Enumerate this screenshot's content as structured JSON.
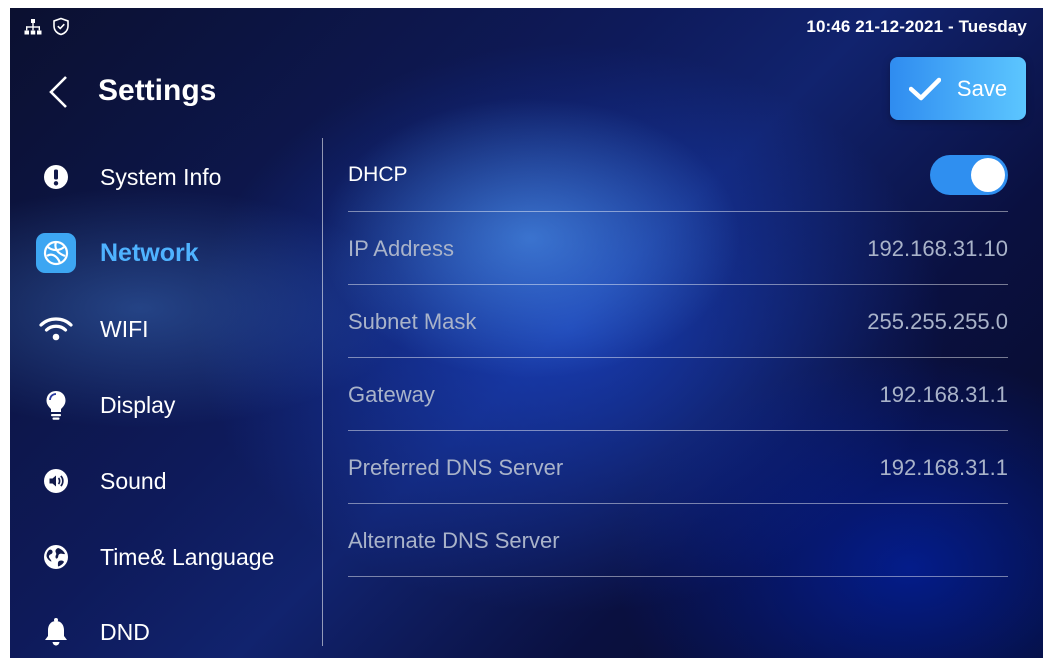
{
  "status_bar": {
    "icons": [
      "network-icon",
      "shield-icon"
    ],
    "datetime": "10:46  21-12-2021 - Tuesday"
  },
  "header": {
    "title": "Settings",
    "save_label": "Save"
  },
  "sidebar": {
    "items": [
      {
        "label": "System Info",
        "icon": "info-icon",
        "active": false
      },
      {
        "label": "Network",
        "icon": "network-globe-icon",
        "active": true
      },
      {
        "label": "WIFI",
        "icon": "wifi-icon",
        "active": false
      },
      {
        "label": "Display",
        "icon": "lightbulb-icon",
        "active": false
      },
      {
        "label": "Sound",
        "icon": "speaker-icon",
        "active": false
      },
      {
        "label": "Time& Language",
        "icon": "globe-icon",
        "active": false
      },
      {
        "label": "DND",
        "icon": "bell-icon",
        "active": false
      }
    ]
  },
  "network": {
    "dhcp": {
      "label": "DHCP",
      "enabled": true
    },
    "fields": [
      {
        "label": "IP Address",
        "value": "192.168.31.10"
      },
      {
        "label": "Subnet Mask",
        "value": "255.255.255.0"
      },
      {
        "label": "Gateway",
        "value": "192.168.31.1"
      },
      {
        "label": "Preferred DNS Server",
        "value": "192.168.31.1"
      },
      {
        "label": "Alternate DNS Server",
        "value": ""
      }
    ]
  },
  "colors": {
    "accent": "#3da6f2",
    "active_text": "#4fb3ff",
    "muted_text": "#a9b3c9"
  }
}
